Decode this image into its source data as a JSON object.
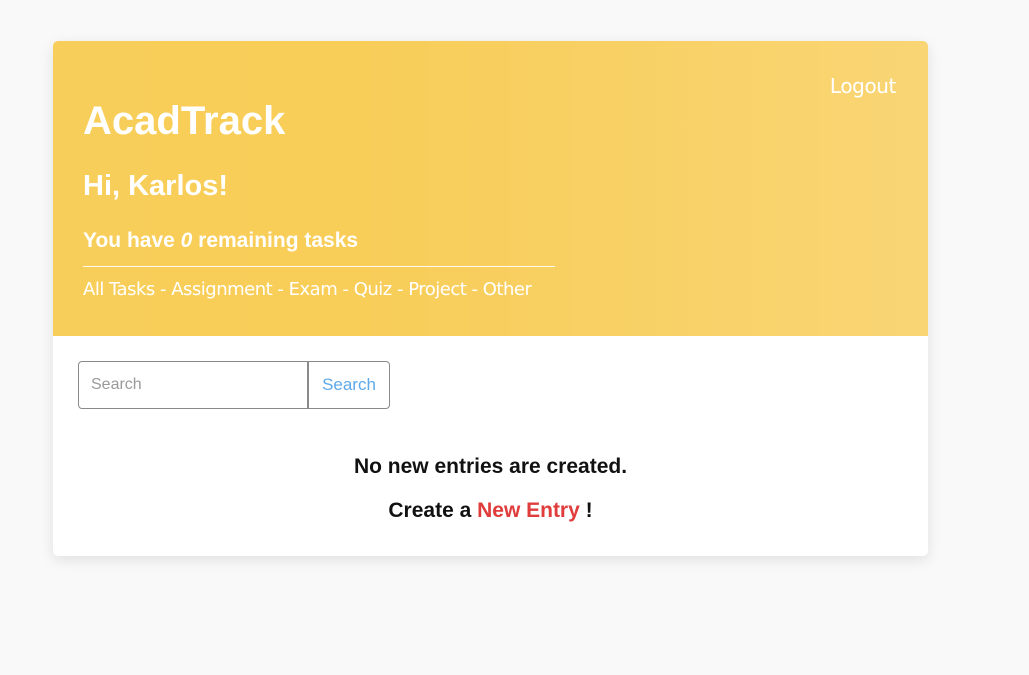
{
  "header": {
    "logout_label": "Logout",
    "brand": "AcadTrack",
    "greeting": "Hi, Karlos!",
    "tasks_prefix": "You have ",
    "tasks_count": "0",
    "tasks_suffix": " remaining tasks",
    "filters": [
      {
        "label": "All Tasks"
      },
      {
        "label": "Assignment"
      },
      {
        "label": "Exam"
      },
      {
        "label": "Quiz"
      },
      {
        "label": "Project"
      },
      {
        "label": "Other"
      }
    ],
    "filter_separator": " - "
  },
  "search": {
    "placeholder": "Search",
    "value": "",
    "button_label": "Search"
  },
  "empty_state": {
    "message": "No new entries are created.",
    "create_prefix": "Create a ",
    "create_link": "New Entry",
    "create_suffix": " !"
  },
  "colors": {
    "header_bg": "#f8ce5a",
    "link_red": "#e03c3c",
    "search_button_text": "#5da9e9",
    "page_bg": "#f9f9f9"
  }
}
